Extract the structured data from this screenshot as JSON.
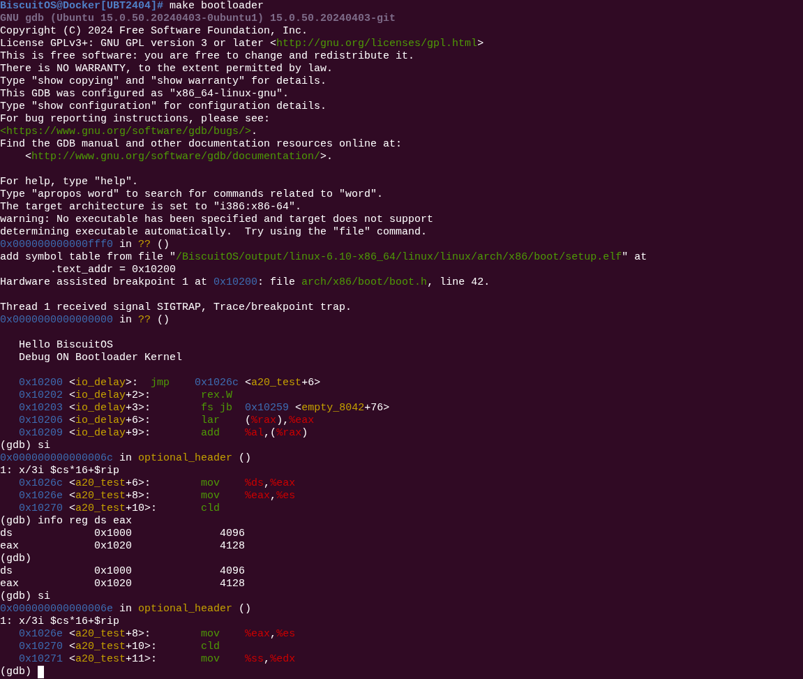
{
  "terminal": {
    "lines": [
      {
        "kind": "text",
        "segments": [
          {
            "kind": "prompt",
            "text": "BiscuitOS@Docker[UBT2404]#"
          },
          {
            "kind": "plain",
            "text": " make bootloader"
          }
        ]
      },
      {
        "kind": "text",
        "segments": [
          {
            "kind": "banner",
            "text": "GNU gdb (Ubuntu 15.0.50.20240403-0ubuntu1) 15.0.50.20240403-git"
          }
        ]
      },
      {
        "kind": "text",
        "segments": [
          {
            "kind": "plain",
            "text": "Copyright (C) 2024 Free Software Foundation, Inc."
          }
        ]
      },
      {
        "kind": "text",
        "segments": [
          {
            "kind": "plain",
            "text": "License GPLv3+: GNU GPL version 3 or later <"
          },
          {
            "kind": "string",
            "text": "http://gnu.org/licenses/gpl.html"
          },
          {
            "kind": "plain",
            "text": ">"
          }
        ]
      },
      {
        "kind": "text",
        "segments": [
          {
            "kind": "plain",
            "text": "This is free software: you are free to change and redistribute it."
          }
        ]
      },
      {
        "kind": "text",
        "segments": [
          {
            "kind": "plain",
            "text": "There is NO WARRANTY, to the extent permitted by law."
          }
        ]
      },
      {
        "kind": "text",
        "segments": [
          {
            "kind": "plain",
            "text": "Type \"show copying\" and \"show warranty\" for details."
          }
        ]
      },
      {
        "kind": "text",
        "segments": [
          {
            "kind": "plain",
            "text": "This GDB was configured as \"x86_64-linux-gnu\"."
          }
        ]
      },
      {
        "kind": "text",
        "segments": [
          {
            "kind": "plain",
            "text": "Type \"show configuration\" for configuration details."
          }
        ]
      },
      {
        "kind": "text",
        "segments": [
          {
            "kind": "plain",
            "text": "For bug reporting instructions, please see:"
          }
        ]
      },
      {
        "kind": "text",
        "segments": [
          {
            "kind": "string",
            "text": "<https://www.gnu.org/software/gdb/bugs/>"
          },
          {
            "kind": "plain",
            "text": "."
          }
        ]
      },
      {
        "kind": "text",
        "segments": [
          {
            "kind": "plain",
            "text": "Find the GDB manual and other documentation resources online at:"
          }
        ]
      },
      {
        "kind": "text",
        "segments": [
          {
            "kind": "plain",
            "text": "    <"
          },
          {
            "kind": "string",
            "text": "http://www.gnu.org/software/gdb/documentation/"
          },
          {
            "kind": "plain",
            "text": ">."
          }
        ]
      },
      {
        "kind": "blank"
      },
      {
        "kind": "text",
        "segments": [
          {
            "kind": "plain",
            "text": "For help, type \"help\"."
          }
        ]
      },
      {
        "kind": "text",
        "segments": [
          {
            "kind": "plain",
            "text": "Type \"apropos word\" to search for commands related to \"word\"."
          }
        ]
      },
      {
        "kind": "text",
        "segments": [
          {
            "kind": "plain",
            "text": "The target architecture is set to \"i386:x86-64\"."
          }
        ]
      },
      {
        "kind": "text",
        "segments": [
          {
            "kind": "plain",
            "text": "warning: No executable has been specified and target does not support"
          }
        ]
      },
      {
        "kind": "text",
        "segments": [
          {
            "kind": "plain",
            "text": "determining executable automatically.  Try using the \"file\" command."
          }
        ]
      },
      {
        "kind": "text",
        "segments": [
          {
            "kind": "address",
            "text": "0x000000000000fff0"
          },
          {
            "kind": "plain",
            "text": " in "
          },
          {
            "kind": "symbol",
            "text": "??"
          },
          {
            "kind": "plain",
            "text": " ()"
          }
        ]
      },
      {
        "kind": "text",
        "segments": [
          {
            "kind": "plain",
            "text": "add symbol table from file \""
          },
          {
            "kind": "string",
            "text": "/BiscuitOS/output/linux-6.10-x86_64/linux/linux/arch/x86/boot/setup.elf"
          },
          {
            "kind": "plain",
            "text": "\" at"
          }
        ]
      },
      {
        "kind": "text",
        "segments": [
          {
            "kind": "plain",
            "text": "        .text_addr = 0x10200"
          }
        ]
      },
      {
        "kind": "text",
        "segments": [
          {
            "kind": "plain",
            "text": "Hardware assisted breakpoint 1 at "
          },
          {
            "kind": "address",
            "text": "0x10200"
          },
          {
            "kind": "plain",
            "text": ": file "
          },
          {
            "kind": "string",
            "text": "arch/x86/boot/boot.h"
          },
          {
            "kind": "plain",
            "text": ", line 42."
          }
        ]
      },
      {
        "kind": "blank"
      },
      {
        "kind": "text",
        "segments": [
          {
            "kind": "plain",
            "text": "Thread 1 received signal SIGTRAP, Trace/breakpoint trap."
          }
        ]
      },
      {
        "kind": "text",
        "segments": [
          {
            "kind": "address",
            "text": "0x0000000000000000"
          },
          {
            "kind": "plain",
            "text": " in "
          },
          {
            "kind": "symbol",
            "text": "??"
          },
          {
            "kind": "plain",
            "text": " ()"
          }
        ]
      },
      {
        "kind": "blank"
      },
      {
        "kind": "listing",
        "segments": [
          {
            "kind": "plain",
            "text": "Hello BiscuitOS"
          }
        ]
      },
      {
        "kind": "listing",
        "segments": [
          {
            "kind": "plain",
            "text": "Debug ON Bootloader Kernel"
          }
        ]
      },
      {
        "kind": "blank"
      },
      {
        "kind": "listing",
        "segments": [
          {
            "kind": "address",
            "text": "0x10200"
          },
          {
            "kind": "plain",
            "text": " <"
          },
          {
            "kind": "symbol",
            "text": "io_delay"
          },
          {
            "kind": "plain",
            "text": ">:  "
          },
          {
            "kind": "opcode",
            "text": "jmp    "
          },
          {
            "kind": "address",
            "text": "0x1026c"
          },
          {
            "kind": "plain",
            "text": " <"
          },
          {
            "kind": "symbol",
            "text": "a20_test"
          },
          {
            "kind": "plain",
            "text": "+6>"
          }
        ]
      },
      {
        "kind": "listing",
        "segments": [
          {
            "kind": "address",
            "text": "0x10202"
          },
          {
            "kind": "plain",
            "text": " <"
          },
          {
            "kind": "symbol",
            "text": "io_delay"
          },
          {
            "kind": "plain",
            "text": "+2>:        "
          },
          {
            "kind": "opcode",
            "text": "rex.W"
          }
        ]
      },
      {
        "kind": "listing",
        "segments": [
          {
            "kind": "address",
            "text": "0x10203"
          },
          {
            "kind": "plain",
            "text": " <"
          },
          {
            "kind": "symbol",
            "text": "io_delay"
          },
          {
            "kind": "plain",
            "text": "+3>:        "
          },
          {
            "kind": "opcode",
            "text": "fs jb  "
          },
          {
            "kind": "address",
            "text": "0x10259"
          },
          {
            "kind": "plain",
            "text": " <"
          },
          {
            "kind": "symbol",
            "text": "empty_8042"
          },
          {
            "kind": "plain",
            "text": "+76>"
          }
        ]
      },
      {
        "kind": "listing",
        "segments": [
          {
            "kind": "address",
            "text": "0x10206"
          },
          {
            "kind": "plain",
            "text": " <"
          },
          {
            "kind": "symbol",
            "text": "io_delay"
          },
          {
            "kind": "plain",
            "text": "+6>:        "
          },
          {
            "kind": "opcode",
            "text": "lar"
          },
          {
            "kind": "plain",
            "text": "    ("
          },
          {
            "kind": "register",
            "text": "%rax"
          },
          {
            "kind": "plain",
            "text": "),"
          },
          {
            "kind": "register",
            "text": "%eax"
          }
        ]
      },
      {
        "kind": "listing",
        "segments": [
          {
            "kind": "address",
            "text": "0x10209"
          },
          {
            "kind": "plain",
            "text": " <"
          },
          {
            "kind": "symbol",
            "text": "io_delay"
          },
          {
            "kind": "plain",
            "text": "+9>:        "
          },
          {
            "kind": "opcode",
            "text": "add    "
          },
          {
            "kind": "register",
            "text": "%al"
          },
          {
            "kind": "plain",
            "text": ",("
          },
          {
            "kind": "register",
            "text": "%rax"
          },
          {
            "kind": "plain",
            "text": ")"
          }
        ]
      },
      {
        "kind": "text",
        "segments": [
          {
            "kind": "plain",
            "text": "(gdb) si"
          }
        ]
      },
      {
        "kind": "text",
        "segments": [
          {
            "kind": "address",
            "text": "0x000000000000006c"
          },
          {
            "kind": "plain",
            "text": " in "
          },
          {
            "kind": "symbol",
            "text": "optional_header"
          },
          {
            "kind": "plain",
            "text": " ()"
          }
        ]
      },
      {
        "kind": "text",
        "segments": [
          {
            "kind": "plain",
            "text": "1: x/3i $cs*16+$rip"
          }
        ]
      },
      {
        "kind": "listing",
        "segments": [
          {
            "kind": "address",
            "text": "0x1026c"
          },
          {
            "kind": "plain",
            "text": " <"
          },
          {
            "kind": "symbol",
            "text": "a20_test"
          },
          {
            "kind": "plain",
            "text": "+6>:        "
          },
          {
            "kind": "opcode",
            "text": "mov    "
          },
          {
            "kind": "register",
            "text": "%ds"
          },
          {
            "kind": "plain",
            "text": ","
          },
          {
            "kind": "register",
            "text": "%eax"
          }
        ]
      },
      {
        "kind": "listing",
        "segments": [
          {
            "kind": "address",
            "text": "0x1026e"
          },
          {
            "kind": "plain",
            "text": " <"
          },
          {
            "kind": "symbol",
            "text": "a20_test"
          },
          {
            "kind": "plain",
            "text": "+8>:        "
          },
          {
            "kind": "opcode",
            "text": "mov    "
          },
          {
            "kind": "register",
            "text": "%eax"
          },
          {
            "kind": "plain",
            "text": ","
          },
          {
            "kind": "register",
            "text": "%es"
          }
        ]
      },
      {
        "kind": "listing",
        "segments": [
          {
            "kind": "address",
            "text": "0x10270"
          },
          {
            "kind": "plain",
            "text": " <"
          },
          {
            "kind": "symbol",
            "text": "a20_test"
          },
          {
            "kind": "plain",
            "text": "+10>:       "
          },
          {
            "kind": "opcode",
            "text": "cld"
          }
        ]
      },
      {
        "kind": "text",
        "segments": [
          {
            "kind": "plain",
            "text": "(gdb) info reg ds eax"
          }
        ]
      },
      {
        "kind": "text",
        "segments": [
          {
            "kind": "plain",
            "text": "ds             0x1000              4096"
          }
        ]
      },
      {
        "kind": "text",
        "segments": [
          {
            "kind": "plain",
            "text": "eax            0x1020              4128"
          }
        ]
      },
      {
        "kind": "text",
        "segments": [
          {
            "kind": "plain",
            "text": "(gdb)"
          }
        ]
      },
      {
        "kind": "text",
        "segments": [
          {
            "kind": "plain",
            "text": "ds             0x1000              4096"
          }
        ]
      },
      {
        "kind": "text",
        "segments": [
          {
            "kind": "plain",
            "text": "eax            0x1020              4128"
          }
        ]
      },
      {
        "kind": "text",
        "segments": [
          {
            "kind": "plain",
            "text": "(gdb) si"
          }
        ]
      },
      {
        "kind": "text",
        "segments": [
          {
            "kind": "address",
            "text": "0x000000000000006e"
          },
          {
            "kind": "plain",
            "text": " in "
          },
          {
            "kind": "symbol",
            "text": "optional_header"
          },
          {
            "kind": "plain",
            "text": " ()"
          }
        ]
      },
      {
        "kind": "text",
        "segments": [
          {
            "kind": "plain",
            "text": "1: x/3i $cs*16+$rip"
          }
        ]
      },
      {
        "kind": "listing",
        "segments": [
          {
            "kind": "address",
            "text": "0x1026e"
          },
          {
            "kind": "plain",
            "text": " <"
          },
          {
            "kind": "symbol",
            "text": "a20_test"
          },
          {
            "kind": "plain",
            "text": "+8>:        "
          },
          {
            "kind": "opcode",
            "text": "mov    "
          },
          {
            "kind": "register",
            "text": "%eax"
          },
          {
            "kind": "plain",
            "text": ","
          },
          {
            "kind": "register",
            "text": "%es"
          }
        ]
      },
      {
        "kind": "listing",
        "segments": [
          {
            "kind": "address",
            "text": "0x10270"
          },
          {
            "kind": "plain",
            "text": " <"
          },
          {
            "kind": "symbol",
            "text": "a20_test"
          },
          {
            "kind": "plain",
            "text": "+10>:       "
          },
          {
            "kind": "opcode",
            "text": "cld"
          }
        ]
      },
      {
        "kind": "listing",
        "segments": [
          {
            "kind": "address",
            "text": "0x10271"
          },
          {
            "kind": "plain",
            "text": " <"
          },
          {
            "kind": "symbol",
            "text": "a20_test"
          },
          {
            "kind": "plain",
            "text": "+11>:       "
          },
          {
            "kind": "opcode",
            "text": "mov    "
          },
          {
            "kind": "register",
            "text": "%ss"
          },
          {
            "kind": "plain",
            "text": ","
          },
          {
            "kind": "register",
            "text": "%edx"
          }
        ]
      },
      {
        "kind": "prompt",
        "text": "(gdb)",
        "cursor": true
      }
    ]
  }
}
